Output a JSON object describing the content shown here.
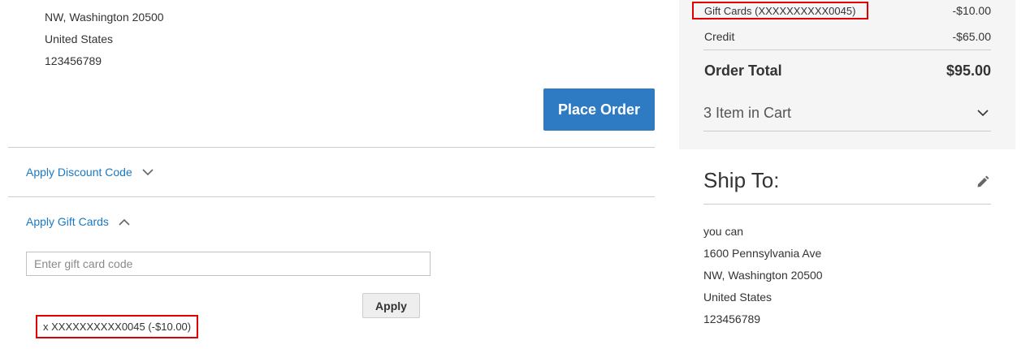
{
  "billing_address": {
    "lines": [
      "NW, Washington 20500",
      "United States",
      "123456789"
    ]
  },
  "actions": {
    "place_order_label": "Place Order"
  },
  "discount": {
    "title": "Apply Discount Code"
  },
  "gift_cards": {
    "title": "Apply Gift Cards",
    "input_placeholder": "Enter gift card code",
    "apply_label": "Apply",
    "applied_card": "x XXXXXXXXXX0045 (-$10.00)"
  },
  "summary": {
    "gift_cards_label": "Gift Cards (XXXXXXXXXX0045)",
    "gift_cards_value": "-$10.00",
    "credit_label": "Credit",
    "credit_value": "-$65.00",
    "order_total_label": "Order Total",
    "order_total_value": "$95.00",
    "cart_label": "3 Item in Cart"
  },
  "ship_to": {
    "title": "Ship To:",
    "lines": [
      "you can",
      "1600 Pennsylvania Ave",
      "NW, Washington 20500",
      "United States",
      "123456789"
    ]
  },
  "colors": {
    "primary_button": "#2e7bc4",
    "link": "#1979c3",
    "highlight_border": "#e00000",
    "summary_background": "#f5f5f5"
  }
}
